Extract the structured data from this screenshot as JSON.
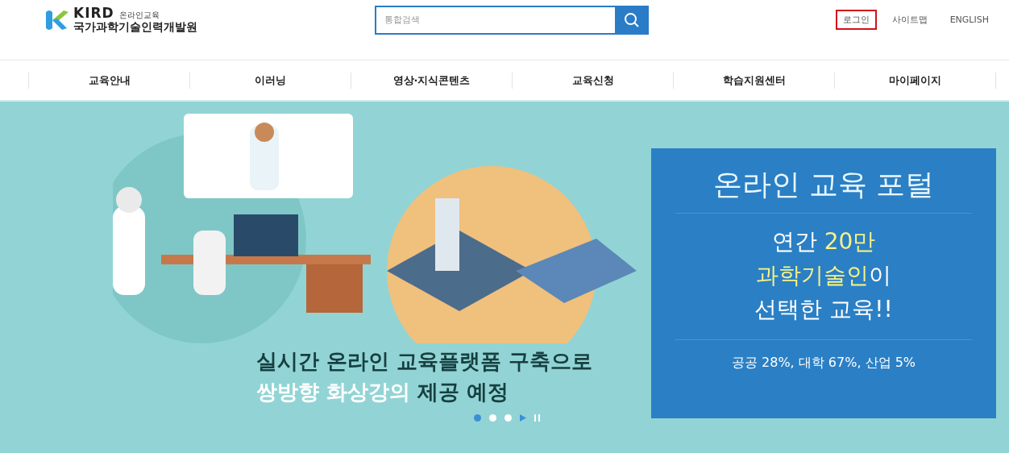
{
  "logo": {
    "brand": "KIRD",
    "tagline": "온라인교육",
    "org": "국가과학기술인력개발원"
  },
  "search": {
    "placeholder": "통합검색"
  },
  "util_links": [
    {
      "label": "로그인",
      "highlighted": true
    },
    {
      "label": "사이트맵",
      "highlighted": false
    },
    {
      "label": "ENGLISH",
      "highlighted": false
    }
  ],
  "nav": [
    "교육안내",
    "이러닝",
    "영상·지식콘텐츠",
    "교육신청",
    "학습지원센터",
    "마이페이지"
  ],
  "hero": {
    "headline": [
      [
        {
          "text": "실시간 온라인 교육플랫폼 구축으로",
          "accent": false
        }
      ],
      [
        {
          "text": "쌍방향 화상강의",
          "accent": true
        },
        {
          "text": " 제공 예정",
          "accent": false
        }
      ]
    ],
    "panel": {
      "title": "온라인 교육 포털",
      "lines": [
        [
          {
            "text": "연간 ",
            "accent": false
          },
          {
            "text": "20만",
            "accent": true
          }
        ],
        [
          {
            "text": "과학기술인",
            "accent": true
          },
          {
            "text": "이",
            "accent": false
          }
        ],
        [
          {
            "text": "선택한 교육!!",
            "accent": false
          }
        ]
      ],
      "footnote": "공공 28%, 대학 67%, 산업 5%"
    },
    "slides": [
      {
        "selected": true
      },
      {
        "selected": false
      },
      {
        "selected": false
      }
    ]
  }
}
